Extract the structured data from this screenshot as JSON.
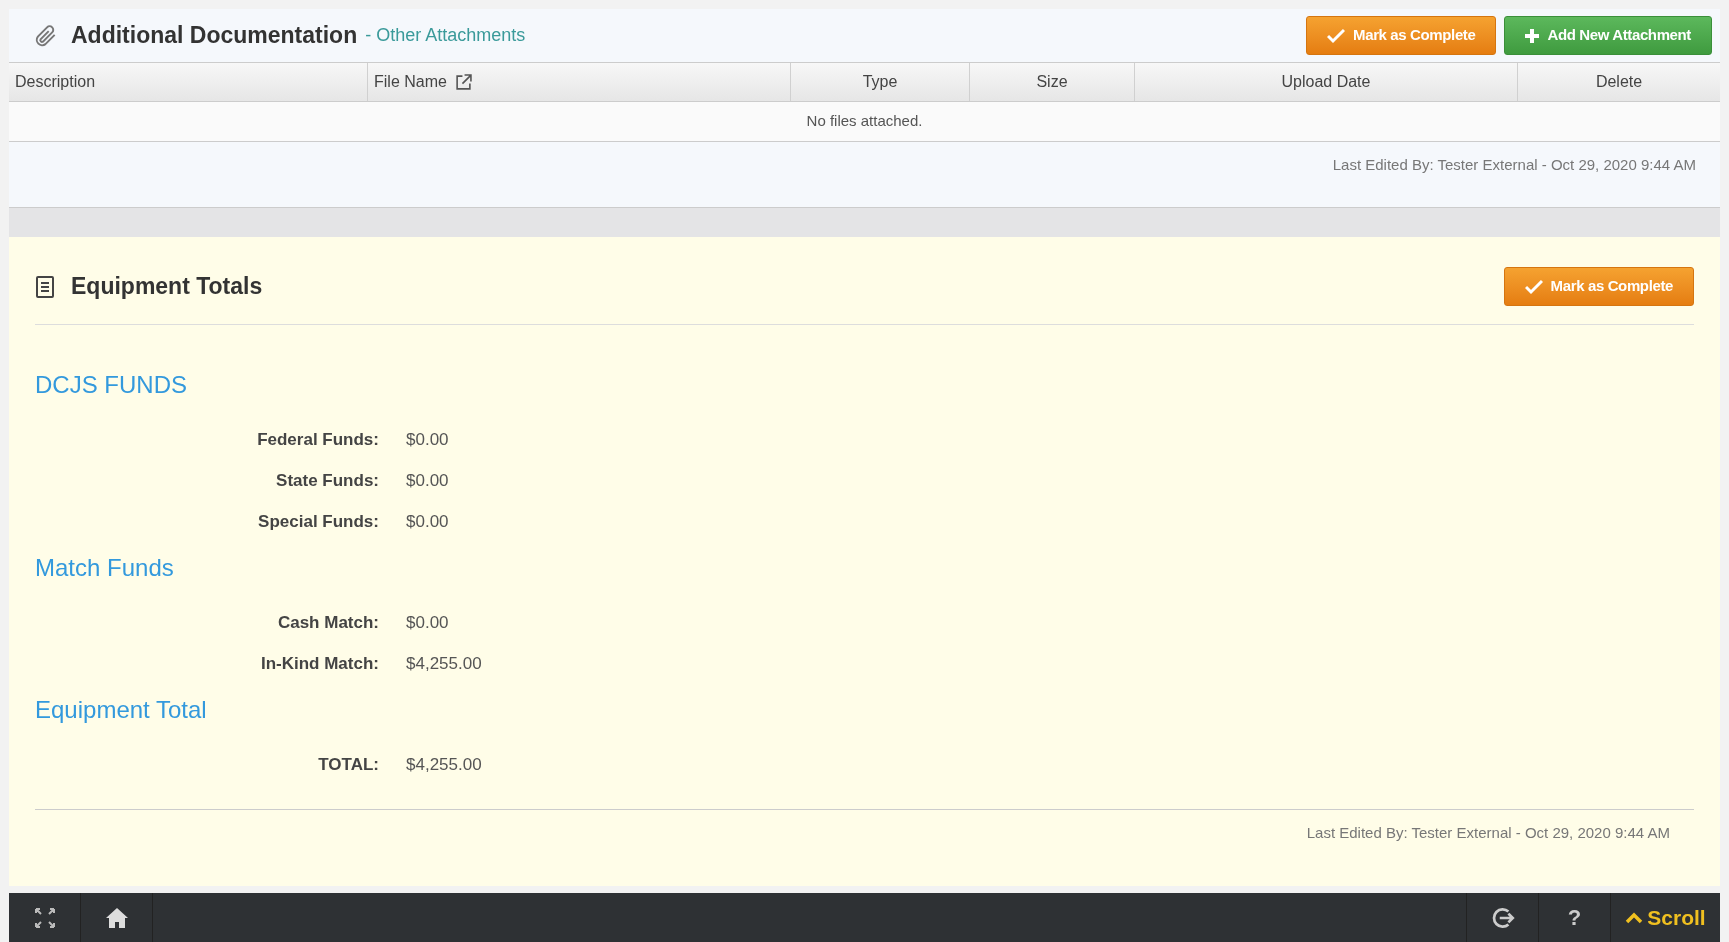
{
  "attachments": {
    "title": "Additional Documentation",
    "subtitle": "- Other Attachments",
    "buttons": [
      {
        "kind": "complete",
        "label": "Mark as Complete"
      },
      {
        "kind": "add",
        "label": "Add New Attachment"
      }
    ],
    "columns": [
      {
        "label": "Description",
        "link": false
      },
      {
        "label": "File Name",
        "link": true
      },
      {
        "label": "Type",
        "link": false
      },
      {
        "label": "Size",
        "link": false
      },
      {
        "label": "Upload Date",
        "link": false
      },
      {
        "label": "Delete",
        "link": false
      }
    ],
    "empty_message": "No files attached.",
    "last_edited": "Last Edited By: Tester External - Oct 29, 2020 9:44 AM"
  },
  "equipment": {
    "title": "Equipment Totals",
    "button": "Mark as Complete",
    "groups": [
      {
        "heading": "DCJS FUNDS",
        "rows": [
          {
            "label": "Federal Funds:",
            "value": "$0.00"
          },
          {
            "label": "State Funds:",
            "value": "$0.00"
          },
          {
            "label": "Special Funds:",
            "value": "$0.00"
          }
        ]
      },
      {
        "heading": "Match Funds",
        "rows": [
          {
            "label": "Cash Match:",
            "value": "$0.00"
          },
          {
            "label": "In-Kind Match:",
            "value": "$4,255.00"
          }
        ]
      },
      {
        "heading": "Equipment Total",
        "rows": [
          {
            "label": "TOTAL:",
            "value": "$4,255.00"
          }
        ]
      }
    ],
    "last_edited": "Last Edited By: Tester External - Oct 29, 2020 9:44 AM"
  },
  "bottom_bar": {
    "help": "?",
    "scroll": "Scroll"
  }
}
